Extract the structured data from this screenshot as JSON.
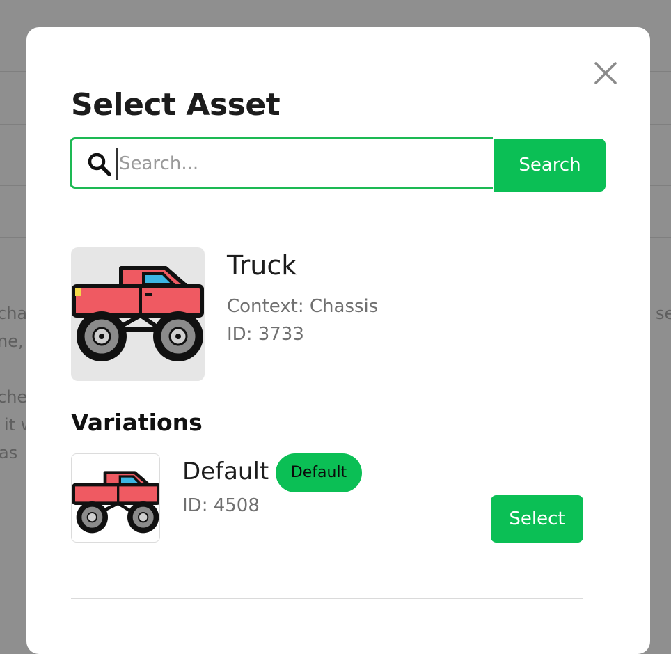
{
  "background": {
    "left_fragments": [
      "chat",
      "ne,",
      "che",
      "it w",
      "as"
    ],
    "right_fragments": [
      "se"
    ]
  },
  "modal": {
    "title": "Select Asset",
    "close_icon": "close-icon",
    "search": {
      "placeholder": "Search...",
      "value": "",
      "button_label": "Search",
      "icon": "search-icon"
    },
    "asset": {
      "name": "Truck",
      "context": "Context: Chassis",
      "id": "ID: 3733",
      "image": "monster-truck-icon"
    },
    "variations": {
      "heading": "Variations",
      "items": [
        {
          "name": "Default",
          "badge": "Default",
          "id": "ID: 4508",
          "select_label": "Select",
          "image": "monster-truck-icon"
        }
      ]
    }
  },
  "colors": {
    "accent": "#0bbf55",
    "overlay": "#8f8f8f",
    "truck_body": "#ef5a62",
    "truck_window": "#3cb6e3"
  }
}
